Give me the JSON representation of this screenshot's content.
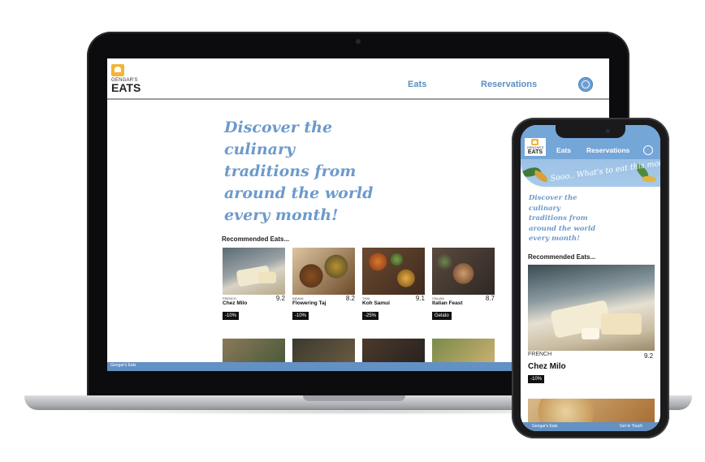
{
  "brand": {
    "small": "GENGAR'S",
    "big": "EATS"
  },
  "desktop": {
    "nav": {
      "eats": "Eats",
      "reservations": "Reservations"
    },
    "headline": "Discover the\nculinary\ntraditions from\naround the world\nevery month!",
    "recommended_label": "Recommended Eats...",
    "cards": [
      {
        "cuisine": "FRENCH",
        "name": "Chez Milo",
        "score": "9.2",
        "badge": "-10%"
      },
      {
        "cuisine": "INDIAN",
        "name": "Flowering Taj",
        "score": "8.2",
        "badge": "-10%"
      },
      {
        "cuisine": "THAI",
        "name": "Koh Samui",
        "score": "9.1",
        "badge": "-25%"
      },
      {
        "cuisine": "ITALIAN",
        "name": "Italian Feast",
        "score": "8.7",
        "badge": "Gelato"
      }
    ],
    "footer": "Gengar's Eats"
  },
  "mobile": {
    "nav": {
      "eats": "Eats",
      "reservations": "Reservations"
    },
    "slogan": "Sooo.. What's to eat this month?",
    "headline": "Discover the\nculinary\ntraditions from\naround the world\nevery month!",
    "recommended_label": "Recommended Eats...",
    "card": {
      "cuisine": "FRENCH",
      "name": "Chez Milo",
      "score": "9.2",
      "badge": "-10%"
    },
    "footer_left": "Gengar's Eats",
    "footer_right": "Get in Touch"
  },
  "colors": {
    "accent": "#6d9acb",
    "footer": "#6391c4",
    "logo": "#f2b53a"
  }
}
